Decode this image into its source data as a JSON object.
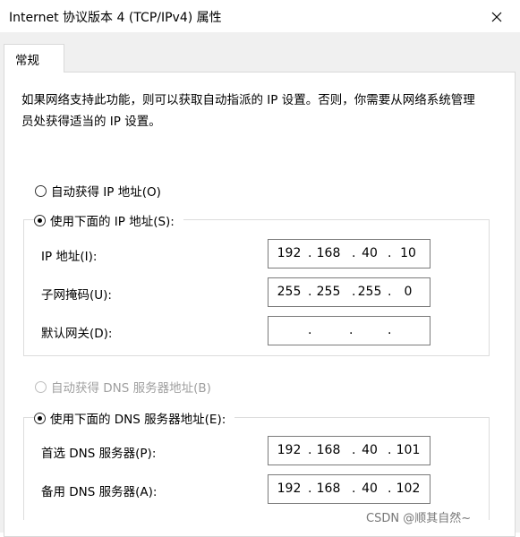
{
  "window": {
    "title": "Internet 协议版本 4 (TCP/IPv4) 属性",
    "close_icon": "close-icon"
  },
  "tabs": [
    {
      "label": "常规"
    }
  ],
  "description": "如果网络支持此功能，则可以获取自动指派的 IP 设置。否则，你需要从网络系统管理员处获得适当的 IP 设置。",
  "ip_section": {
    "auto_label": "自动获得 IP 地址(O)",
    "auto_selected": false,
    "manual_label": "使用下面的 IP 地址(S):",
    "manual_selected": true,
    "fields": [
      {
        "label": "IP 地址(I):",
        "octets": [
          "192",
          "168",
          "40",
          "10"
        ]
      },
      {
        "label": "子网掩码(U):",
        "octets": [
          "255",
          "255",
          "255",
          "0"
        ]
      },
      {
        "label": "默认网关(D):",
        "octets": [
          "",
          "",
          "",
          ""
        ]
      }
    ]
  },
  "dns_section": {
    "auto_label": "自动获得 DNS 服务器地址(B)",
    "auto_selected": false,
    "auto_disabled": true,
    "manual_label": "使用下面的 DNS 服务器地址(E):",
    "manual_selected": true,
    "fields": [
      {
        "label": "首选 DNS 服务器(P):",
        "octets": [
          "192",
          "168",
          "40",
          "101"
        ]
      },
      {
        "label": "备用 DNS 服务器(A):",
        "octets": [
          "192",
          "168",
          "40",
          "102"
        ]
      }
    ]
  },
  "watermark": "CSDN @顺其自然~"
}
